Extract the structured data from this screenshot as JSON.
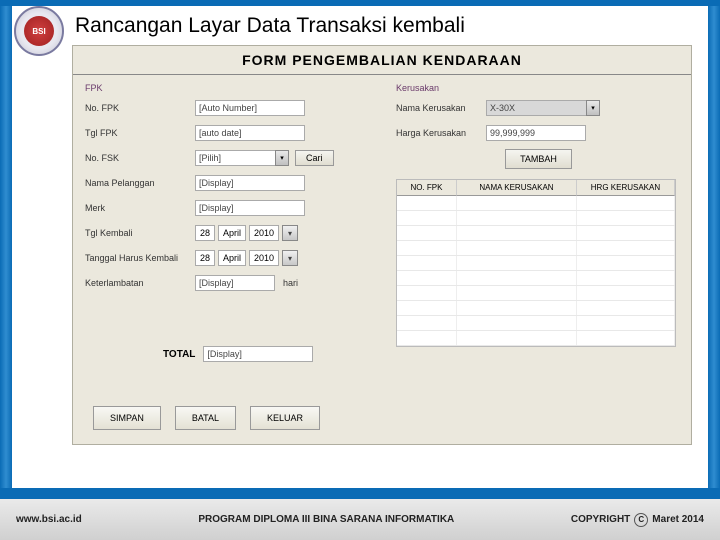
{
  "page_title": "Rancangan Layar Data Transaksi kembali",
  "form_header": "FORM PENGEMBALIAN KENDARAAN",
  "fpk": {
    "section": "FPK",
    "no_fpk": {
      "label": "No. FPK",
      "value": "[Auto Number]"
    },
    "tgl_fpk": {
      "label": "Tgl FPK",
      "value": "[auto date]"
    },
    "no_fsk": {
      "label": "No. FSK",
      "value": "[Pilih]",
      "cari": "Cari"
    },
    "nama_pelanggan": {
      "label": "Nama Pelanggan",
      "value": "[Display]"
    },
    "merk": {
      "label": "Merk",
      "value": "[Display]"
    },
    "tgl_kembali": {
      "label": "Tgl Kembali",
      "d": "28",
      "m": "April",
      "y": "2010"
    },
    "tgl_harus": {
      "label": "Tanggal Harus Kembali",
      "d": "28",
      "m": "April",
      "y": "2010"
    },
    "keterlambatan": {
      "label": "Keterlambatan",
      "value": "[Display]",
      "unit": "hari"
    }
  },
  "kerusakan": {
    "section": "Kerusakan",
    "nama": {
      "label": "Nama Kerusakan",
      "value": "X-30X"
    },
    "harga": {
      "label": "Harga Kerusakan",
      "value": "99,999,999"
    },
    "tambah": "TAMBAH",
    "cols": {
      "c1": "NO. FPK",
      "c2": "NAMA KERUSAKAN",
      "c3": "HRG KERUSAKAN"
    }
  },
  "total": {
    "label": "TOTAL",
    "value": "[Display]"
  },
  "actions": {
    "simpan": "SIMPAN",
    "batal": "BATAL",
    "keluar": "KELUAR"
  },
  "footer": {
    "url": "www.bsi.ac.id",
    "center": "PROGRAM DIPLOMA III BINA SARANA INFORMATIKA",
    "copyright": "COPYRIGHT",
    "date": "Maret 2014"
  }
}
